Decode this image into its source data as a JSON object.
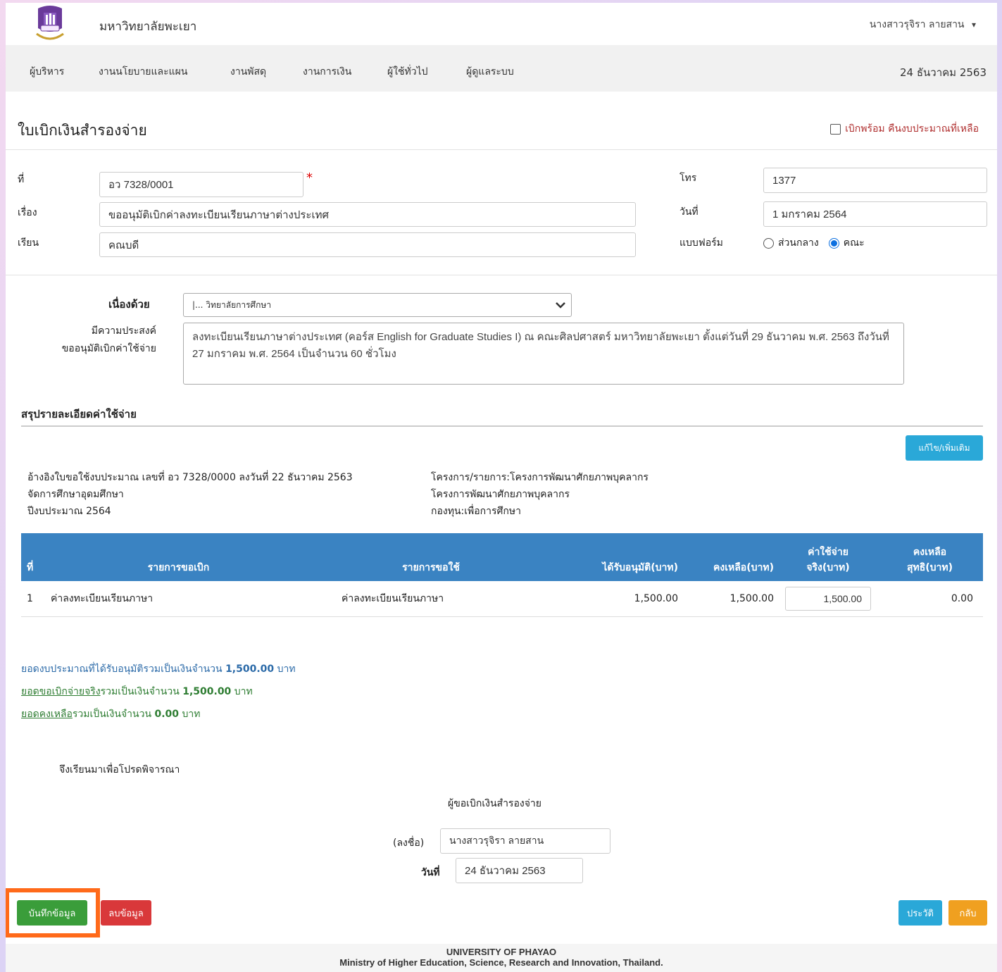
{
  "header": {
    "university_name": "มหาวิทยาลัยพะเยา",
    "user_name": "นางสาวรุจิรา ลายสาน",
    "user_caret": "▾"
  },
  "nav": {
    "items": [
      "ผู้บริหาร",
      "งานนโยบายและแผน",
      "งานพัสดุ",
      "งานการเงิน",
      "ผู้ใช้ทั่วไป",
      "ผู้ดูแลระบบ"
    ],
    "date": "24 ธันวาคม 2563"
  },
  "form": {
    "title": "ใบเบิกเงินสำรองจ่าย",
    "return_budget_label": "เบิกพร้อม คืนงบประมาณที่เหลือ",
    "no_label": "ที่",
    "no_value": "อว 7328/0001",
    "required_mark": "*",
    "subject_label": "เรื่อง",
    "subject_value": "ขออนุมัติเบิกค่าลงทะเบียนเรียนภาษาต่างประเทศ",
    "to_label": "เรียน",
    "to_value": "คณบดี",
    "phone_label": "โทร",
    "phone_value": "1377",
    "date_label": "วันที่",
    "date_value": "1 มกราคม 2564",
    "form_type_label": "แบบฟอร์ม",
    "form_type_central": "ส่วนกลาง",
    "form_type_faculty": "คณะ",
    "because_label": "เนื่องด้วย",
    "because_value": "|... วิทยาลัยการศึกษา",
    "purpose_label_1": "มีความประสงค์",
    "purpose_label_2": "ขออนุมัติเบิกค่าใช้จ่าย",
    "purpose_value": "ลงทะเบียนเรียนภาษาต่างประเทศ (คอร์ส English for Graduate Studies I) ณ คณะศิลปศาสตร์ มหาวิทยาลัยพะเยา ตั้งแต่วันที่ 29 ธันวาคม พ.ศ. 2563 ถึงวันที่ 27 มกราคม พ.ศ. 2564 เป็นจำนวน 60 ชั่วโมง"
  },
  "summary": {
    "heading": "สรุปรายละเอียดค่าใช้จ่าย",
    "edit_button": "แก้ไข/เพิ่มเติม",
    "ref_line_1": "อ้างอิงใบขอใช้งบประมาณ เลขที่ อว 7328/0000 ลงวันที่ 22 ธันวาคม 2563",
    "ref_line_2": "จัดการศึกษาอุดมศึกษา",
    "ref_line_3": "ปีงบประมาณ 2564",
    "project_line_1": "โครงการ/รายการ:โครงการพัฒนาศักยภาพบุคลากร",
    "project_line_2": "โครงการพัฒนาศักยภาพบุคลากร",
    "project_line_3": "กองทุน:เพื่อการศึกษา"
  },
  "table": {
    "headers": {
      "no": "ที่",
      "request_item": "รายการขอเบิก",
      "use_item": "รายการขอใช้",
      "approved": "ได้รับอนุมัติ(บาท)",
      "remaining": "คงเหลือ(บาท)",
      "actual_1": "ค่าใช้จ่าย",
      "actual_2": "จริง(บาท)",
      "net_1": "คงเหลือ",
      "net_2": "สุทธิ(บาท)"
    },
    "rows": [
      {
        "no": "1",
        "request_item": "ค่าลงทะเบียนเรียนภาษา",
        "use_item": "ค่าลงทะเบียนเรียนภาษา",
        "approved": "1,500.00",
        "remaining": "1,500.00",
        "actual": "1,500.00",
        "net": "0.00"
      }
    ]
  },
  "totals": {
    "approved_text": "ยอดงบประมาณที่ได้รับอนุมัติรวมเป็นเงินจำนวน",
    "approved_amount": "1,500.00",
    "approved_unit": "บาท",
    "actual_link": "ยอดขอเบิกจ่ายจริง",
    "actual_text": "รวมเป็นเงินจำนวน",
    "actual_amount": "1,500.00",
    "actual_unit": "บาท",
    "remain_link": "ยอดคงเหลือ",
    "remain_text": "รวมเป็นเงินจำนวน",
    "remain_amount": "0.00",
    "remain_unit": "บาท"
  },
  "signature": {
    "closing": "จึงเรียนมาเพื่อโปรดพิจารณา",
    "requester_title": "ผู้ขอเบิกเงินสำรองจ่าย",
    "sign_label": "(ลงชื่อ)",
    "sign_value": "นางสาวรุจิรา ลายสาน",
    "date_label": "วันที่",
    "date_value": "24 ธันวาคม 2563"
  },
  "actions": {
    "save": "บันทึกข้อมูล",
    "delete": "ลบข้อมูล",
    "history": "ประวัติ",
    "back": "กลับ"
  },
  "footer": {
    "line1": "UNIVERSITY OF PHAYAO",
    "line2": "Ministry of Higher Education, Science, Research and Innovation, Thailand."
  },
  "colors": {
    "primary_blue": "#3a83c2",
    "save_green": "#3a9d3a",
    "delete_red": "#d9383a",
    "info_cyan": "#2aa8d8",
    "warning_orange": "#f0a020",
    "highlight_orange": "#ff6a1a",
    "link_blue": "#2b6aa8"
  }
}
